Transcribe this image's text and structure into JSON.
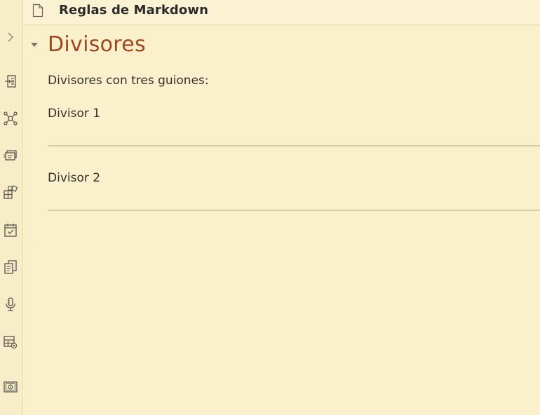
{
  "header": {
    "title": "Reglas de Markdown",
    "doc_icon": "file-icon"
  },
  "ribbon": {
    "expand_icon": "chevron-right-icon",
    "icons": [
      "file-export-icon",
      "graph-icon",
      "stacked-cards-icon",
      "blocks-icon",
      "calendar-check-icon",
      "copy-documents-icon",
      "microphone-icon",
      "table-settings-icon",
      "safe-icon"
    ]
  },
  "document": {
    "heading": "Divisores",
    "paragraphs": [
      "Divisores con tres guiones:",
      "Divisor 1",
      "Divisor 2"
    ]
  },
  "colors": {
    "background": "#faf1cc",
    "heading": "#a0481f",
    "divider": "#d9cda3"
  }
}
